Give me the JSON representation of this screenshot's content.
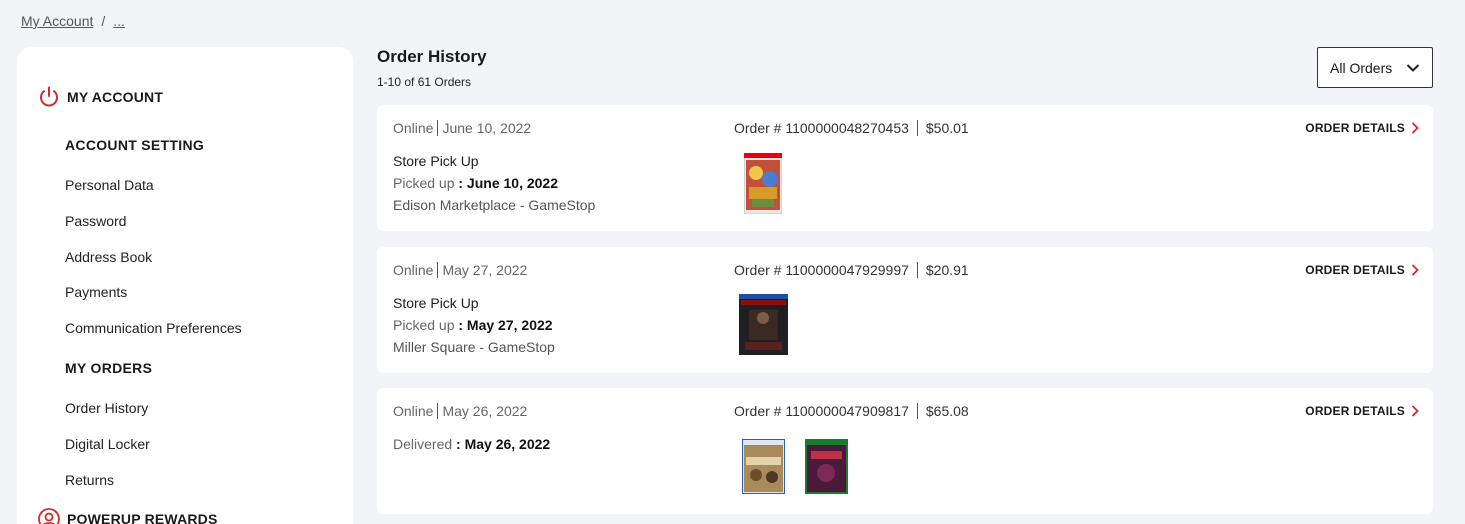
{
  "breadcrumb": {
    "root": "My Account",
    "separator": "/",
    "current": "..."
  },
  "sidebar": {
    "my_account": "MY ACCOUNT",
    "account_setting": "ACCOUNT SETTING",
    "account_links": [
      "Personal Data",
      "Password",
      "Address Book",
      "Payments",
      "Communication Preferences"
    ],
    "my_orders": "MY ORDERS",
    "order_links": [
      "Order History",
      "Digital Locker",
      "Returns"
    ],
    "powerup": "POWERUP REWARDS"
  },
  "header": {
    "title": "Order History",
    "subtitle": "1-10 of 61 Orders",
    "filter_label": "All Orders"
  },
  "orders": [
    {
      "channel": "Online",
      "date": "June 10, 2022",
      "order_label": "Order # 1100000048270453",
      "total": "$50.01",
      "details_label": "ORDER DETAILS",
      "method": "Store Pick Up",
      "status_label": "Picked up",
      "status_date": ": June 10, 2022",
      "store": "Edison Marketplace - GameStop"
    },
    {
      "channel": "Online",
      "date": "May 27, 2022",
      "order_label": "Order # 1100000047929997",
      "total": "$20.91",
      "details_label": "ORDER DETAILS",
      "method": "Store Pick Up",
      "status_label": "Picked up",
      "status_date": ": May 27, 2022",
      "store": "Miller Square - GameStop"
    },
    {
      "channel": "Online",
      "date": "May 26, 2022",
      "order_label": "Order # 1100000047909817",
      "total": "$65.08",
      "details_label": "ORDER DETAILS",
      "status_label": "Delivered",
      "status_date": ": May 26, 2022"
    }
  ],
  "colors": {
    "accent": "#d22b2b",
    "background": "#f3f4f7",
    "card": "#ffffff"
  }
}
